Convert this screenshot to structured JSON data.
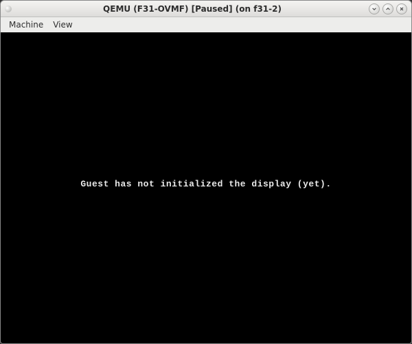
{
  "titlebar": {
    "title": "QEMU (F31-OVMF) [Paused] (on f31-2)"
  },
  "menubar": {
    "items": [
      {
        "label": "Machine"
      },
      {
        "label": "View"
      }
    ]
  },
  "display": {
    "message": "Guest has not initialized the display (yet)."
  }
}
